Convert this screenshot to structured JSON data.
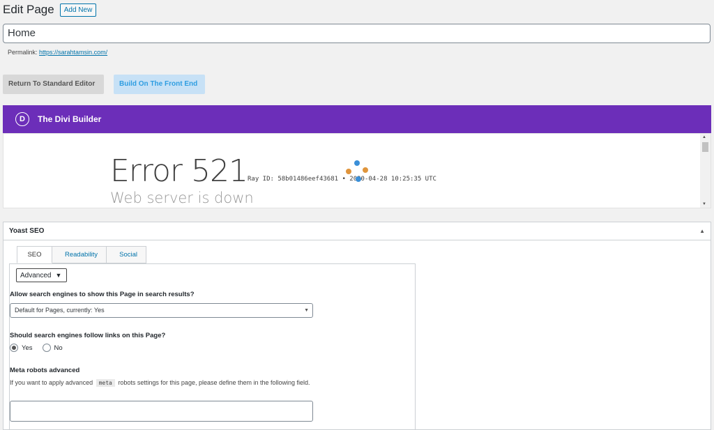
{
  "header": {
    "title": "Edit Page",
    "add_new": "Add New"
  },
  "post": {
    "title_value": "Home"
  },
  "permalink": {
    "label": "Permalink:",
    "url": "https://sarahtamsin.com/"
  },
  "editor_buttons": {
    "standard": "Return To Standard Editor",
    "front": "Build On The Front End"
  },
  "divi": {
    "logo_letter": "D",
    "title": "The Divi Builder",
    "error_code": "Error 521",
    "ray_text": "Ray ID: 58b01486eef43681 • 2020-04-28 10:25:35 UTC",
    "error_sub": "Web server is down"
  },
  "yoast": {
    "title": "Yoast SEO",
    "tabs": [
      {
        "label": "SEO"
      },
      {
        "label": "Readability"
      },
      {
        "label": "Social"
      }
    ],
    "advanced_label": "Advanced",
    "search_label": "Allow search engines to show this Page in search results?",
    "search_value": "Default for Pages, currently: Yes",
    "follow_label": "Should search engines follow links on this Page?",
    "follow_yes": "Yes",
    "follow_no": "No",
    "meta_label": "Meta robots advanced",
    "meta_help_pre": "If you want to apply advanced",
    "meta_help_code": "meta",
    "meta_help_post": "robots settings for this page, please define them in the following field.",
    "meta_value": ""
  },
  "colors": {
    "divi_purple": "#6c2eb9",
    "wp_blue": "#0073aa",
    "loader_blue": "#3a8fd8",
    "loader_orange": "#e0953c"
  }
}
